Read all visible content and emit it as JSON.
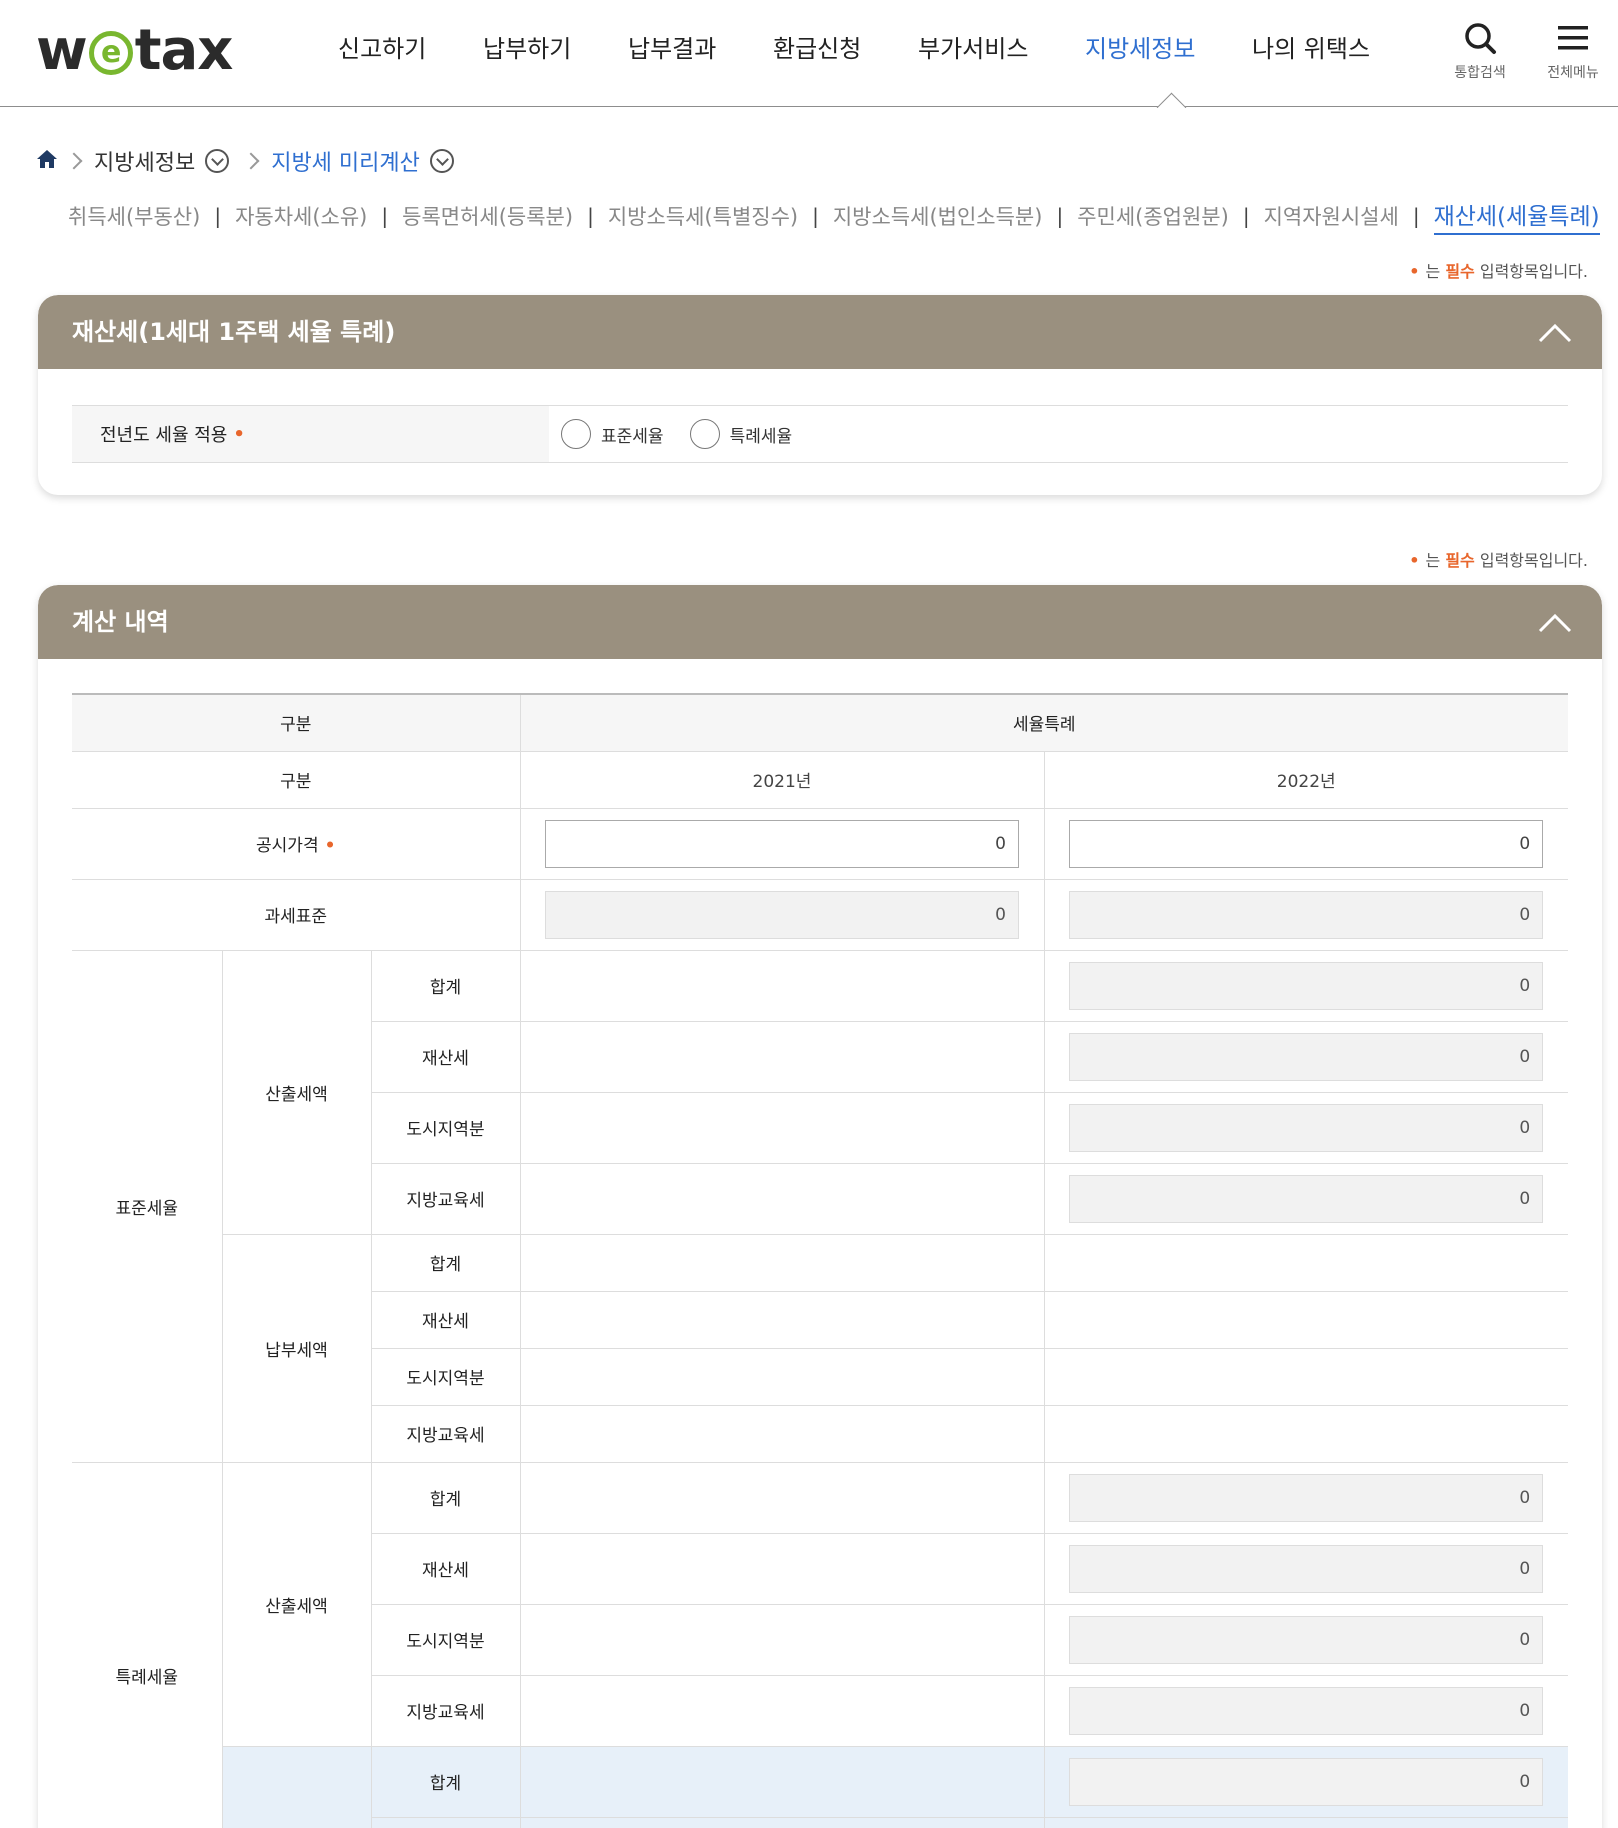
{
  "header": {
    "logo": "wetax",
    "nav": [
      "신고하기",
      "납부하기",
      "납부결과",
      "환급신청",
      "부가서비스",
      "지방세정보",
      "나의 위택스"
    ],
    "active_nav": "지방세정보",
    "search_label": "통합검색",
    "menu_label": "전체메뉴"
  },
  "breadcrumb": {
    "level1": "지방세정보",
    "level2": "지방세 미리계산"
  },
  "subtabs": [
    "취득세(부동산)",
    "자동차세(소유)",
    "등록면허세(등록분)",
    "지방소득세(특별징수)",
    "지방소득세(법인소득분)",
    "주민세(종업원분)",
    "지역자원시설세",
    "재산세(세율특례)"
  ],
  "active_subtab": "재산세(세율특례)",
  "required_note": {
    "prefix": "는 ",
    "req": "필수",
    "suffix": " 입력항목입니다."
  },
  "panel1": {
    "title": "재산세(1세대 1주택 세율 특례)",
    "row_label": "전년도 세율 적용",
    "options": [
      "표준세율",
      "특례세율"
    ]
  },
  "panel2": {
    "title": "계산 내역",
    "head_gubun": "구분",
    "head_special": "세율특례",
    "sub_gubun": "구분",
    "years": [
      "2021년",
      "2022년"
    ],
    "public_price": {
      "label": "공시가격",
      "v2021": "0",
      "v2022": "0"
    },
    "tax_base": {
      "label": "과세표준",
      "v2021": "0",
      "v2022": "0"
    },
    "group_standard": "표준세율",
    "group_special": "특례세율",
    "calc_label": "산출세액",
    "pay_label": "납부세액",
    "items": [
      "합계",
      "재산세",
      "도시지역분",
      "지방교육세"
    ],
    "standard_calc_values": [
      "0",
      "0",
      "0",
      "0"
    ],
    "special_calc_values": [
      "0",
      "0",
      "0",
      "0"
    ],
    "special_pay_first_value": "0"
  }
}
